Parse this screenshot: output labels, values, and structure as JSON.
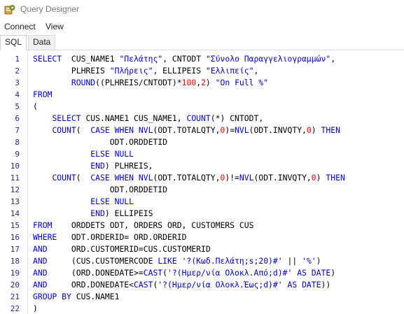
{
  "window": {
    "title": "Query Designer"
  },
  "menu": {
    "items": [
      "Connect",
      "View"
    ]
  },
  "tabs": [
    {
      "label": "SQL",
      "active": true
    },
    {
      "label": "Data",
      "active": false
    }
  ],
  "colors": {
    "keyword": "#0000c8",
    "string": "#0000c8",
    "number": "#ff0000",
    "plain": "#000000",
    "line_number": "#2b2b8f"
  },
  "editor": {
    "lines": [
      [
        [
          "k",
          "SELECT"
        ],
        [
          "p",
          "  CUS_NAME1 "
        ],
        [
          "s",
          "\"Πελάτης\""
        ],
        [
          "p",
          ", CNTODT "
        ],
        [
          "s",
          "\"Σύνολο Παραγγελιογραμμών\""
        ],
        [
          "p",
          ","
        ]
      ],
      [
        [
          "p",
          "        PLHREIS "
        ],
        [
          "s",
          "\"Πλήρεις\""
        ],
        [
          "p",
          ", ELLIPEIS "
        ],
        [
          "s",
          "\"Ελλιπείς\""
        ],
        [
          "p",
          ","
        ]
      ],
      [
        [
          "p",
          "        "
        ],
        [
          "k",
          "ROUND"
        ],
        [
          "p",
          "((PLHREIS/CNTODT)*"
        ],
        [
          "n",
          "100"
        ],
        [
          "p",
          ","
        ],
        [
          "n",
          "2"
        ],
        [
          "p",
          ") "
        ],
        [
          "s",
          "\"On Full %\""
        ]
      ],
      [
        [
          "k",
          "FROM"
        ]
      ],
      [
        [
          "p",
          "("
        ]
      ],
      [
        [
          "p",
          "    "
        ],
        [
          "k",
          "SELECT"
        ],
        [
          "p",
          " CUS.NAME1 CUS_NAME1, "
        ],
        [
          "k",
          "COUNT"
        ],
        [
          "p",
          "(*) CNTODT,"
        ]
      ],
      [
        [
          "p",
          "    "
        ],
        [
          "k",
          "COUNT"
        ],
        [
          "p",
          "(  "
        ],
        [
          "k",
          "CASE WHEN NVL"
        ],
        [
          "p",
          "(ODT.TOTALQTY,"
        ],
        [
          "n",
          "0"
        ],
        [
          "p",
          ")="
        ],
        [
          "k",
          "NVL"
        ],
        [
          "p",
          "(ODT.INVQTY,"
        ],
        [
          "n",
          "0"
        ],
        [
          "p",
          ") "
        ],
        [
          "k",
          "THEN"
        ]
      ],
      [
        [
          "p",
          "                ODT.ORDDETID"
        ]
      ],
      [
        [
          "p",
          "            "
        ],
        [
          "k",
          "ELSE NULL"
        ]
      ],
      [
        [
          "p",
          "            "
        ],
        [
          "k",
          "END"
        ],
        [
          "p",
          ") PLHREIS,"
        ]
      ],
      [
        [
          "p",
          "    "
        ],
        [
          "k",
          "COUNT"
        ],
        [
          "p",
          "(  "
        ],
        [
          "k",
          "CASE WHEN NVL"
        ],
        [
          "p",
          "(ODT.TOTALQTY,"
        ],
        [
          "n",
          "0"
        ],
        [
          "p",
          ")!="
        ],
        [
          "k",
          "NVL"
        ],
        [
          "p",
          "(ODT.INVQTY,"
        ],
        [
          "n",
          "0"
        ],
        [
          "p",
          ") "
        ],
        [
          "k",
          "THEN"
        ]
      ],
      [
        [
          "p",
          "                ODT.ORDDETID"
        ]
      ],
      [
        [
          "p",
          "            "
        ],
        [
          "k",
          "ELSE NULL"
        ]
      ],
      [
        [
          "p",
          "            "
        ],
        [
          "k",
          "END"
        ],
        [
          "p",
          ") ELLIPEIS"
        ]
      ],
      [
        [
          "k",
          "FROM"
        ],
        [
          "p",
          "    ORDDETS ODT, ORDERS ORD, CUSTOMERS CUS"
        ]
      ],
      [
        [
          "k",
          "WHERE"
        ],
        [
          "p",
          "   ODT.ORDERID= ORD.ORDERID"
        ]
      ],
      [
        [
          "k",
          "AND"
        ],
        [
          "p",
          "     ORD.CUSTOMERID=CUS.CUSTOMERID"
        ]
      ],
      [
        [
          "k",
          "AND"
        ],
        [
          "p",
          "     (CUS.CUSTOMERCODE "
        ],
        [
          "k",
          "LIKE"
        ],
        [
          "p",
          " "
        ],
        [
          "s",
          "'?(Κωδ.Πελάτη;s;20)#'"
        ],
        [
          "p",
          " || "
        ],
        [
          "s",
          "'%'"
        ],
        [
          "p",
          ")"
        ]
      ],
      [
        [
          "k",
          "AND"
        ],
        [
          "p",
          "     (ORD.DONEDATE>="
        ],
        [
          "k",
          "CAST"
        ],
        [
          "p",
          "("
        ],
        [
          "s",
          "'?(Ημερ/νία Ολοκλ.Από;d)#'"
        ],
        [
          "p",
          " "
        ],
        [
          "k",
          "AS DATE"
        ],
        [
          "p",
          ")"
        ]
      ],
      [
        [
          "k",
          "AND"
        ],
        [
          "p",
          "     ORD.DONEDATE<"
        ],
        [
          "k",
          "CAST"
        ],
        [
          "p",
          "("
        ],
        [
          "s",
          "'?(Ημερ/νία Ολοκλ.Έως;d)#'"
        ],
        [
          "p",
          " "
        ],
        [
          "k",
          "AS DATE"
        ],
        [
          "p",
          "))"
        ]
      ],
      [
        [
          "k",
          "GROUP BY"
        ],
        [
          "p",
          " CUS.NAME1"
        ]
      ],
      [
        [
          "p",
          ")"
        ]
      ]
    ]
  }
}
